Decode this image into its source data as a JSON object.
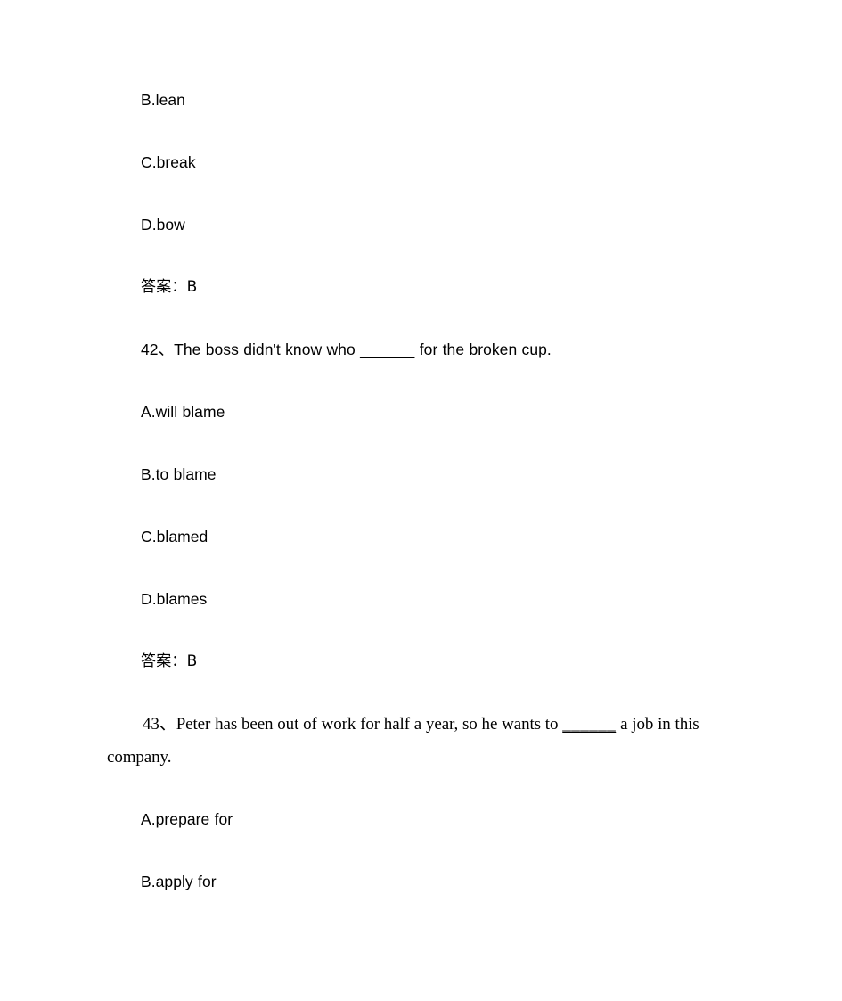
{
  "document": {
    "page_background": "#ffffff",
    "text_color": "#000000",
    "blocks": [
      {
        "kind": "option",
        "name": "option-b-lean",
        "text": "B.lean"
      },
      {
        "kind": "option",
        "name": "option-c-break",
        "text": "C.break"
      },
      {
        "kind": "option",
        "name": "option-d-bow",
        "text": "D.bow"
      },
      {
        "kind": "answer",
        "name": "answer-line-41",
        "text": "答案：B",
        "label": "答案：",
        "value": "B"
      },
      {
        "kind": "question",
        "name": "question-42",
        "number": "42、",
        "text": "42、The boss didn't know who ______ for the broken cup.",
        "before_blank": "42、The boss didn't know who ",
        "blank": "______",
        "after_blank": " for the broken cup."
      },
      {
        "kind": "option",
        "name": "option-a-will-blame",
        "text": "A.will blame"
      },
      {
        "kind": "option",
        "name": "option-b-to-blame",
        "text": "B.to blame"
      },
      {
        "kind": "option",
        "name": "option-c-blamed",
        "text": "C.blamed"
      },
      {
        "kind": "option",
        "name": "option-d-blames",
        "text": "D.blames"
      },
      {
        "kind": "answer",
        "name": "answer-line-42",
        "text": "答案：B",
        "label": "答案：",
        "value": "B"
      },
      {
        "kind": "question-wrap",
        "name": "question-43",
        "number": "43、",
        "text": "43、Peter has been out of work for half a year, so he wants to ______ a job in this company.",
        "before_blank": "43、Peter has been out of work for half a year, so he wants to ",
        "blank": "______",
        "after_blank": " a job in this company."
      },
      {
        "kind": "option",
        "name": "option-a-prepare-for",
        "text": "A.prepare for"
      },
      {
        "kind": "option",
        "name": "option-b-apply-for",
        "text": "B.apply for"
      }
    ]
  }
}
